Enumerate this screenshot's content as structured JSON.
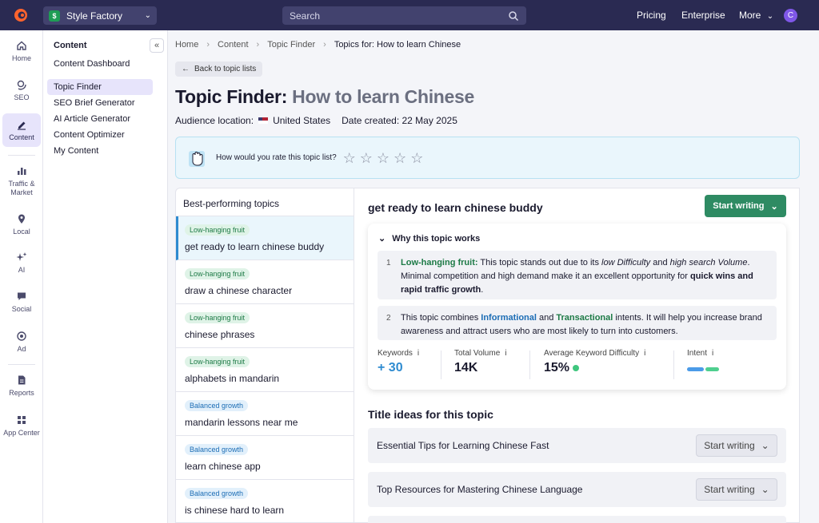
{
  "topbar": {
    "project_name": "Style Factory",
    "search_placeholder": "Search",
    "links": [
      "Pricing",
      "Enterprise",
      "More"
    ],
    "avatar_initial": "C"
  },
  "rail": [
    {
      "label": "Home",
      "icon": "home-icon"
    },
    {
      "label": "SEO",
      "icon": "seo-icon"
    },
    {
      "label": "Content",
      "icon": "pen-icon",
      "active": true
    },
    {
      "label": "Traffic & Market",
      "icon": "bar-chart-icon"
    },
    {
      "label": "Local",
      "icon": "pin-icon"
    },
    {
      "label": "AI",
      "icon": "sparkle-icon"
    },
    {
      "label": "Social",
      "icon": "chat-icon"
    },
    {
      "label": "Ad",
      "icon": "target-icon"
    },
    {
      "label": "Reports",
      "icon": "document-icon"
    },
    {
      "label": "App Center",
      "icon": "grid-icon"
    }
  ],
  "subnav": {
    "title": "Content",
    "items": [
      "Content Dashboard",
      "Topic Finder",
      "SEO Brief Generator",
      "AI Article Generator",
      "Content Optimizer",
      "My Content"
    ]
  },
  "breadcrumb": [
    "Home",
    "Content",
    "Topic Finder",
    "Topics for: How to learn Chinese"
  ],
  "back_label": "Back to topic lists",
  "heading": {
    "prefix": "Topic Finder:",
    "topic": "How to learn Chinese"
  },
  "meta": {
    "location_label": "Audience location:",
    "location": "United States",
    "date_label": "Date created: 22 May 2025"
  },
  "rating": {
    "question": "How would you rate this topic list?",
    "stars": 5
  },
  "list": {
    "header": "Best-performing topics",
    "topics": [
      {
        "tag": "Low-hanging fruit",
        "tag_color": "green",
        "name": "get ready to learn chinese buddy"
      },
      {
        "tag": "Low-hanging fruit",
        "tag_color": "green",
        "name": "draw a chinese character"
      },
      {
        "tag": "Low-hanging fruit",
        "tag_color": "green",
        "name": "chinese phrases"
      },
      {
        "tag": "Low-hanging fruit",
        "tag_color": "green",
        "name": "alphabets in mandarin"
      },
      {
        "tag": "Balanced growth",
        "tag_color": "blue",
        "name": "mandarin lessons near me"
      },
      {
        "tag": "Balanced growth",
        "tag_color": "blue",
        "name": "learn chinese app"
      },
      {
        "tag": "Balanced growth",
        "tag_color": "blue",
        "name": "is chinese hard to learn"
      }
    ]
  },
  "detail": {
    "title": "get ready to learn chinese buddy",
    "start_writing": "Start writing",
    "why_title": "Why this topic works",
    "reason1": {
      "num": "1",
      "lead": "Low-hanging fruit:",
      "t1": " This topic stands out due to its ",
      "em1": "low Difficulty",
      "t2": " and ",
      "em2": "high search Volume",
      "t3": ". Minimal competition and high demand make it an excellent opportunity for ",
      "strong": "quick wins and rapid traffic growth",
      "t4": "."
    },
    "reason2": {
      "num": "2",
      "t1": "This topic combines ",
      "b1": "Informational",
      "t2": " and ",
      "b2": "Transactional",
      "t3": " intents. It will help you increase brand awareness and attract users who are most likely to turn into customers."
    },
    "metrics": {
      "keywords_label": "Keywords",
      "keywords_value": "+ 30",
      "volume_label": "Total Volume",
      "volume_value": "14K",
      "difficulty_label": "Average Keyword Difficulty",
      "difficulty_value": "15%",
      "intent_label": "Intent"
    },
    "titles_header": "Title ideas for this topic",
    "title_ideas": [
      "Essential Tips for Learning Chinese Fast",
      "Top Resources for Mastering Chinese Language"
    ]
  },
  "colors": {
    "topbar": "#2a2a52",
    "accent_green": "#2e8b63",
    "informational": "#4b9be8",
    "transactional": "#4fcf8f"
  }
}
